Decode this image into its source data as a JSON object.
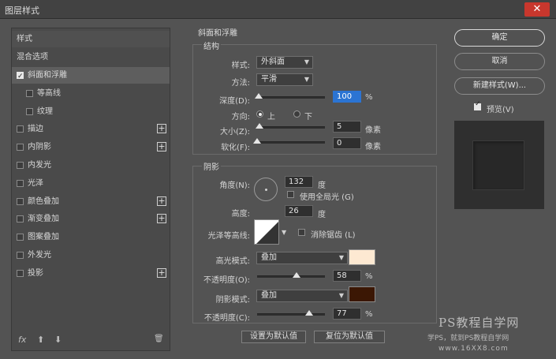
{
  "window": {
    "title": "图层样式",
    "close": "✕"
  },
  "left_panel": {
    "header_style": "样式",
    "blend_options": "混合选项",
    "items": [
      {
        "label": "斜面和浮雕",
        "checked": true,
        "selected": true,
        "plus": false
      },
      {
        "label": "等高线",
        "checked": false,
        "sub": true,
        "plus": false
      },
      {
        "label": "纹理",
        "checked": false,
        "sub": true,
        "plus": false
      },
      {
        "label": "描边",
        "checked": false,
        "plus": true
      },
      {
        "label": "内阴影",
        "checked": false,
        "plus": true
      },
      {
        "label": "内发光",
        "checked": false,
        "plus": false
      },
      {
        "label": "光泽",
        "checked": false,
        "plus": false
      },
      {
        "label": "颜色叠加",
        "checked": false,
        "plus": true
      },
      {
        "label": "渐变叠加",
        "checked": false,
        "plus": true
      },
      {
        "label": "图案叠加",
        "checked": false,
        "plus": false
      },
      {
        "label": "外发光",
        "checked": false,
        "plus": false
      },
      {
        "label": "投影",
        "checked": false,
        "plus": true
      }
    ],
    "plus_glyph": "+",
    "footer": {
      "fx": "fx",
      "up": "⬆",
      "down": "⬇",
      "trash": "🗑"
    }
  },
  "bevel": {
    "section_title": "斜面和浮雕",
    "structure_title": "结构",
    "style_label": "样式:",
    "style_value": "外斜面",
    "method_label": "方法:",
    "method_value": "平滑",
    "depth_label": "深度(D):",
    "depth_value": "100",
    "depth_unit": "%",
    "depth_level": 0.02,
    "direction_label": "方向:",
    "direction_up": "上",
    "direction_down": "下",
    "size_label": "大小(Z):",
    "size_value": "5",
    "size_unit": "像素",
    "size_level": 0.04,
    "soften_label": "软化(F):",
    "soften_value": "0",
    "soften_unit": "像素",
    "soften_level": 0.0
  },
  "shading": {
    "title": "阴影",
    "angle_label": "角度(N):",
    "angle_value": "132",
    "angle_unit": "度",
    "global_light_label": "使用全局光 (G)",
    "altitude_label": "高度:",
    "altitude_value": "26",
    "altitude_unit": "度",
    "gloss_label": "光泽等高线:",
    "antialias_label": "消除锯齿 (L)",
    "highlight_mode_label": "高光模式:",
    "highlight_mode_value": "叠加",
    "highlight_color": "#fde9d2",
    "highlight_opacity_label": "不透明度(O):",
    "highlight_opacity_value": "58",
    "highlight_opacity_level": 0.58,
    "shadow_mode_label": "阴影模式:",
    "shadow_mode_value": "叠加",
    "shadow_color": "#3b1704",
    "shadow_opacity_label": "不透明度(C):",
    "shadow_opacity_value": "77",
    "shadow_opacity_level": 0.77,
    "percent": "%"
  },
  "bottom_buttons": {
    "set_default": "设置为默认值",
    "reset_default": "复位为默认值"
  },
  "right_panel": {
    "ok": "确定",
    "cancel": "取消",
    "new_style": "新建样式(W)...",
    "preview_label": "预览(V)"
  },
  "watermark": {
    "line1": "PS教程自学网",
    "line2": "学PS，就到PS教程自学网",
    "line3": "www.16XX8.com"
  }
}
